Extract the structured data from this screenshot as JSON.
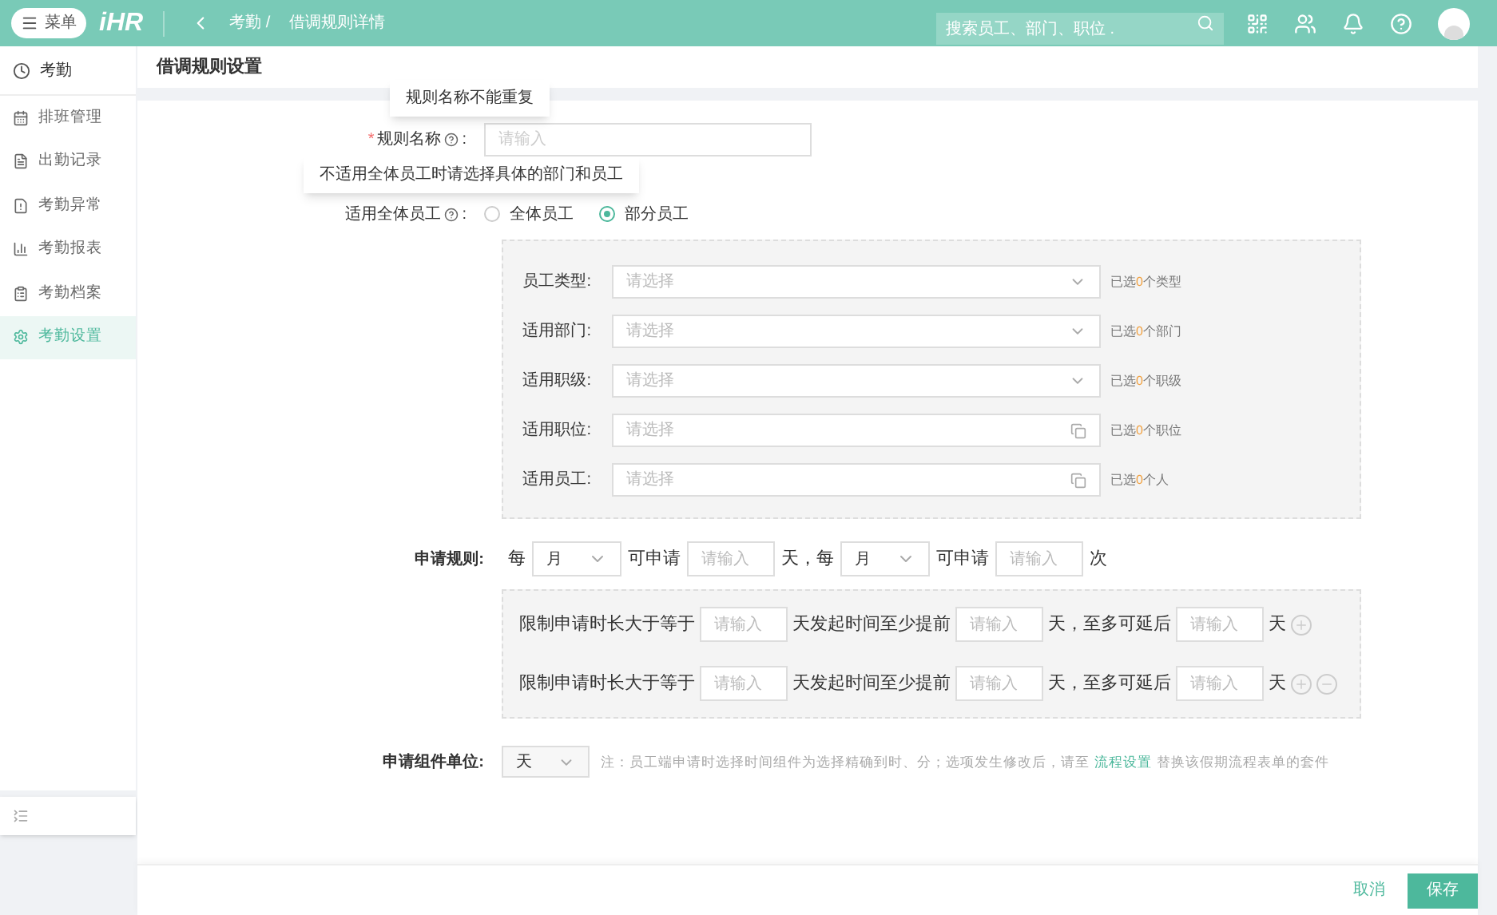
{
  "topbar": {
    "menu_button": "菜单",
    "logo": "iHR",
    "breadcrumb": [
      {
        "label": "考勤 /"
      },
      {
        "label": "借调规则详情"
      }
    ],
    "search": {
      "placeholder": "搜索员工、部门、职位 ."
    }
  },
  "sidebar": {
    "title": "考勤",
    "items": [
      {
        "label": "排班管理",
        "selected": false
      },
      {
        "label": "出勤记录",
        "selected": false
      },
      {
        "label": "考勤异常",
        "selected": false
      },
      {
        "label": "考勤报表",
        "selected": false
      },
      {
        "label": "考勤档案",
        "selected": false
      },
      {
        "label": "考勤设置",
        "selected": true
      }
    ]
  },
  "page_title": "借调规则设置",
  "tooltips": [
    "规则名称不能重复",
    "不适用全体员工时请选择具体的部门和员工"
  ],
  "rule_name": {
    "required_mark": "*",
    "label": "规则名称",
    "colon": ":",
    "placeholder": "请输入"
  },
  "apply_all": {
    "label": "适用全体员工",
    "colon": ":",
    "options": [
      {
        "label": "全体员工",
        "selected": false
      },
      {
        "label": "部分员工",
        "selected": true
      }
    ]
  },
  "scope_rows": [
    {
      "kind": "select",
      "label": "员工类型:",
      "placeholder": "请选择",
      "count_prefix": "已选",
      "count": "0",
      "count_suffix": "个类型"
    },
    {
      "kind": "select",
      "label": "适用部门:",
      "placeholder": "请选择",
      "count_prefix": "已选",
      "count": "0",
      "count_suffix": "个部门"
    },
    {
      "kind": "select",
      "label": "适用职级:",
      "placeholder": "请选择",
      "count_prefix": "已选",
      "count": "0",
      "count_suffix": "个职级"
    },
    {
      "kind": "picker",
      "label": "适用职位:",
      "placeholder": "请选择",
      "count_prefix": "已选",
      "count": "0",
      "count_suffix": "个职位"
    },
    {
      "kind": "picker",
      "label": "适用员工:",
      "placeholder": "请选择",
      "count_prefix": "已选",
      "count": "0",
      "count_suffix": "个人"
    }
  ],
  "apply_rule": {
    "label": "申请规则:",
    "parts": [
      {
        "kind": "text",
        "text": "每"
      },
      {
        "kind": "select",
        "value": "月"
      },
      {
        "kind": "text",
        "text": "可申请"
      },
      {
        "kind": "input",
        "placeholder": "请输入"
      },
      {
        "kind": "text",
        "text": "天，每"
      },
      {
        "kind": "select",
        "value": "月"
      },
      {
        "kind": "text",
        "text": "可申请"
      },
      {
        "kind": "input",
        "placeholder": "请输入"
      },
      {
        "kind": "text",
        "text": "次"
      }
    ]
  },
  "limit_rows": [
    {
      "parts": [
        {
          "kind": "text",
          "text": "限制申请时长大于等于"
        },
        {
          "kind": "input",
          "placeholder": "请输入"
        },
        {
          "kind": "text",
          "text": "天发起时间至少提前"
        },
        {
          "kind": "input",
          "placeholder": "请输入"
        },
        {
          "kind": "text",
          "text": "天，至多可延后"
        },
        {
          "kind": "input",
          "placeholder": "请输入"
        },
        {
          "kind": "text",
          "text": "天"
        },
        {
          "kind": "add"
        }
      ]
    },
    {
      "parts": [
        {
          "kind": "text",
          "text": "限制申请时长大于等于"
        },
        {
          "kind": "input",
          "placeholder": "请输入"
        },
        {
          "kind": "text",
          "text": "天发起时间至少提前"
        },
        {
          "kind": "input",
          "placeholder": "请输入"
        },
        {
          "kind": "text",
          "text": "天，至多可延后"
        },
        {
          "kind": "input",
          "placeholder": "请输入"
        },
        {
          "kind": "text",
          "text": "天"
        },
        {
          "kind": "add"
        },
        {
          "kind": "remove"
        }
      ]
    }
  ],
  "unit": {
    "label": "申请组件单位:",
    "value": "天",
    "note_before": "注：员工端申请时选择时间组件为选择精确到时、分；选项发生修改后，请至",
    "note_link": "流程设置",
    "note_after": "替换该假期流程表单的套件"
  },
  "footer": {
    "cancel": "取消",
    "save": "保存"
  }
}
